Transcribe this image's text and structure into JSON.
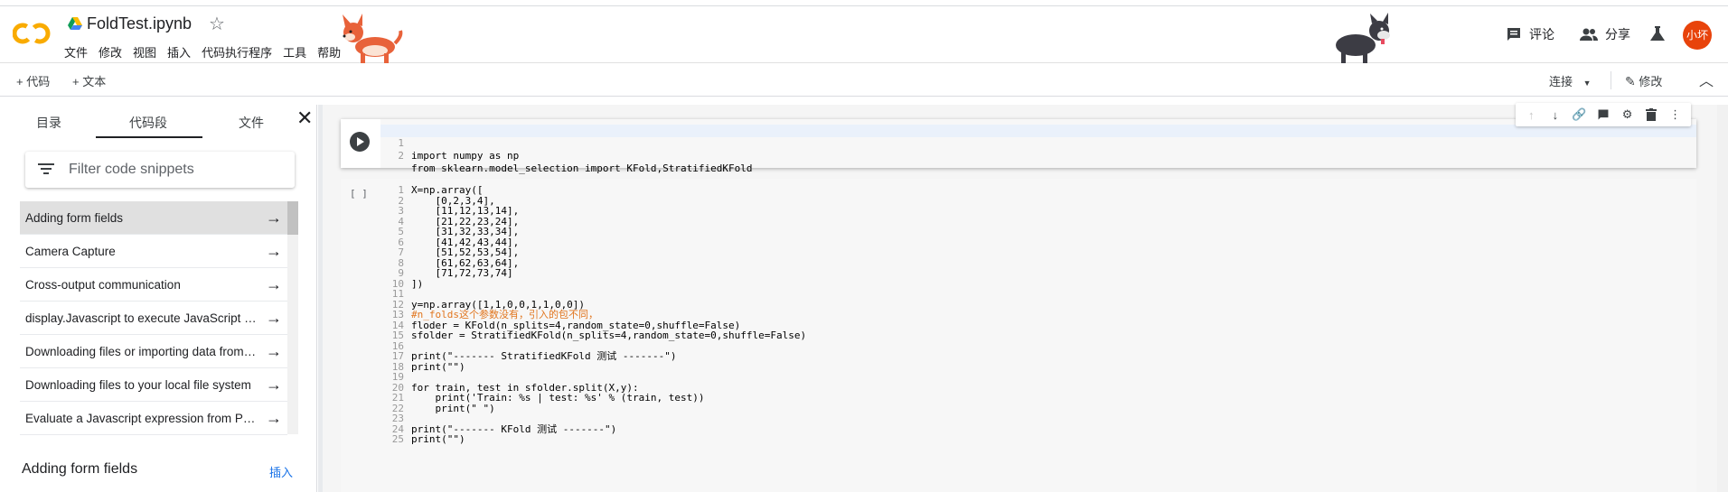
{
  "app": {
    "logo_text": "CO",
    "notebook_title": "FoldTest.ipynb",
    "menu": [
      "文件",
      "修改",
      "视图",
      "插入",
      "代码执行程序",
      "工具",
      "帮助"
    ],
    "comment_label": "评论",
    "share_label": "分享",
    "avatar_text": "小坏"
  },
  "toolbar": {
    "add_code_label": "+ 代码",
    "add_text_label": "+ 文本",
    "connect_label": "连接",
    "edit_label": "修改"
  },
  "sidepanel": {
    "tabs": [
      "目录",
      "代码段",
      "文件"
    ],
    "active_tab": "代码段",
    "filter_placeholder": "Filter code snippets",
    "snippets": [
      "Adding form fields",
      "Camera Capture",
      "Cross-output communication",
      "display.Javascript to execute JavaScript from Python",
      "Downloading files or importing data from Google Drive",
      "Downloading files to your local file system",
      "Evaluate a Javascript expression from Python"
    ],
    "preview_title": "Adding form fields",
    "insert_label": "插入"
  },
  "cells": {
    "cell1": {
      "lines": [
        "import numpy as np",
        "from sklearn.model_selection import KFold,StratifiedKFold"
      ]
    },
    "cell2": {
      "exec_count": "[ ]",
      "lines": [
        "X=np.array([",
        "    [0,2,3,4],",
        "    [11,12,13,14],",
        "    [21,22,23,24],",
        "    [31,32,33,34],",
        "    [41,42,43,44],",
        "    [51,52,53,54],",
        "    [61,62,63,64],",
        "    [71,72,73,74]",
        "])",
        "",
        "y=np.array([1,1,0,0,1,1,0,0])",
        "#n_folds这个参数没有，引入的包不同，",
        "floder = KFold(n_splits=4,random_state=0,shuffle=False)",
        "sfolder = StratifiedKFold(n_splits=4,random_state=0,shuffle=False)",
        "",
        "print(\"------- StratifiedKFold 测试 -------\")",
        "print(\"\")",
        "",
        "for train, test in sfolder.split(X,y):",
        "    print('Train: %s | test: %s' % (train, test))",
        "    print(\" \")",
        "",
        "print(\"------- KFold 测试 -------\")",
        "print(\"\")"
      ]
    }
  },
  "colors": {
    "accent": "#1a73e8",
    "avatar_bg": "#e8430b",
    "logo_orange": "#f9ab00"
  }
}
